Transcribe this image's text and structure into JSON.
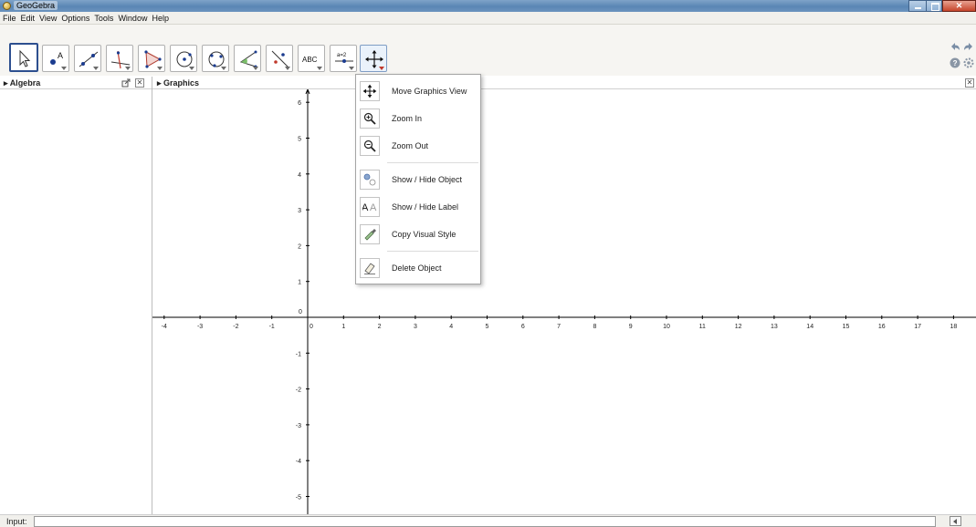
{
  "window": {
    "title": "GeoGebra"
  },
  "menubar": {
    "items": [
      "File",
      "Edit",
      "View",
      "Options",
      "Tools",
      "Window",
      "Help"
    ]
  },
  "toolbar": {
    "tools": [
      {
        "name": "move-tool-button",
        "icon": "pointer-arrow-icon",
        "selected": true
      },
      {
        "name": "point-tool-button",
        "icon": "point-icon"
      },
      {
        "name": "line-tool-button",
        "icon": "line-icon"
      },
      {
        "name": "perpendicular-tool-button",
        "icon": "perpendicular-icon"
      },
      {
        "name": "polygon-tool-button",
        "icon": "polygon-icon"
      },
      {
        "name": "circle-tool-button",
        "icon": "circle-icon"
      },
      {
        "name": "conic-tool-button",
        "icon": "conic-icon"
      },
      {
        "name": "angle-tool-button",
        "icon": "angle-icon"
      },
      {
        "name": "reflect-tool-button",
        "icon": "reflect-icon"
      },
      {
        "name": "text-tool-button",
        "icon": "abc-icon",
        "label": "ABC"
      },
      {
        "name": "slider-tool-button",
        "icon": "slider-icon",
        "label": "a=2"
      },
      {
        "name": "move-graphics-tool-button",
        "icon": "move-cross-icon",
        "active": true
      }
    ]
  },
  "algebra": {
    "title": "Algebra"
  },
  "graphics": {
    "title": "Graphics",
    "x_ticks": [
      -4,
      -3,
      -2,
      -1,
      0,
      1,
      2,
      3,
      4,
      5,
      6,
      7,
      8,
      9,
      10,
      11,
      12,
      13,
      14,
      15,
      16,
      17,
      18
    ],
    "y_ticks": [
      6,
      5,
      4,
      3,
      2,
      1,
      0,
      -1,
      -2,
      -3,
      -4,
      -5
    ],
    "origin_label": "0"
  },
  "dropdown": {
    "items": [
      {
        "label": "Move Graphics View",
        "icon": "move-cross-icon"
      },
      {
        "label": "Zoom In",
        "icon": "zoom-in-icon"
      },
      {
        "label": "Zoom Out",
        "icon": "zoom-out-icon"
      },
      {
        "label": "Show / Hide Object",
        "icon": "show-hide-object-icon"
      },
      {
        "label": "Show / Hide Label",
        "icon": "show-hide-label-icon",
        "glyph": "A A"
      },
      {
        "label": "Copy Visual Style",
        "icon": "copy-style-icon"
      },
      {
        "label": "Delete Object",
        "icon": "eraser-icon"
      }
    ]
  },
  "input": {
    "label": "Input:",
    "value": ""
  }
}
